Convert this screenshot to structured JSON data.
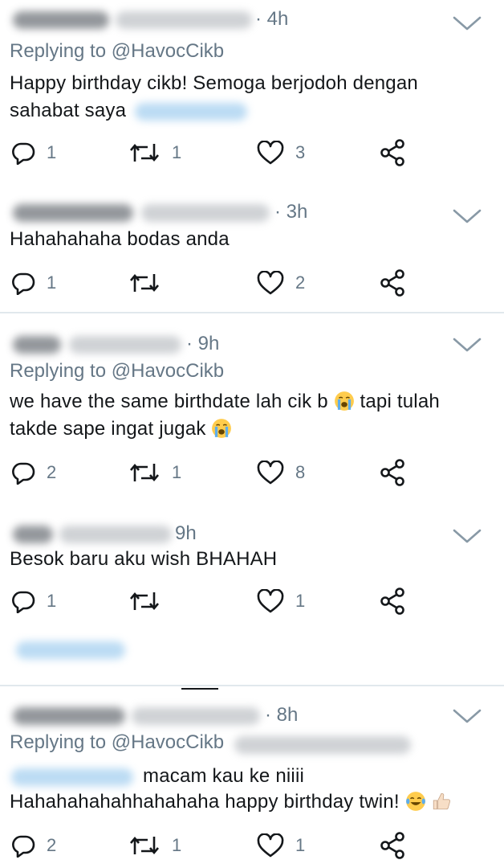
{
  "tweets": [
    {
      "time": "· 4h",
      "replying_prefix": "Replying to",
      "replying_handle": "@HavocCikb",
      "lines": [
        "Happy birthday cikb! Semoga berjodoh dengan",
        "sahabat saya"
      ],
      "replies": "1",
      "retweets": "1",
      "likes": "3"
    },
    {
      "time": "· 3h",
      "lines": [
        "Hahahahaha bodas anda"
      ],
      "replies": "1",
      "retweets": "",
      "likes": "2"
    },
    {
      "time": "· 9h",
      "replying_prefix": "Replying to",
      "replying_handle": "@HavocCikb",
      "lines": [
        "we have the same birthdate lah cik b",
        "tapi tulah",
        "takde sape ingat jugak"
      ],
      "replies": "2",
      "retweets": "1",
      "likes": "8"
    },
    {
      "time": "9h",
      "lines": [
        "Besok baru aku wish BHAHAH"
      ],
      "replies": "1",
      "retweets": "",
      "likes": "1"
    },
    {
      "time": "· 8h",
      "replying_prefix": "Replying to",
      "replying_handle": "@HavocCikb",
      "lines": [
        "macam kau ke niiii",
        "Hahahahahahhahahaha happy birthday twin!"
      ],
      "replies": "2",
      "retweets": "1",
      "likes": "1"
    }
  ],
  "icons": {
    "reply": "reply-icon",
    "retweet": "retweet-icon",
    "like": "heart-icon",
    "share": "share-icon",
    "menu": "chevron-down-icon",
    "emoji_cry": "loudly-crying-face-emoji",
    "emoji_laugh": "tears-of-joy-emoji",
    "emoji_thumb": "thumbs-up-emoji"
  },
  "colors": {
    "text": "#14171a",
    "secondary": "#657786",
    "divider": "#e1e8ed",
    "link": "#1da1f2"
  }
}
